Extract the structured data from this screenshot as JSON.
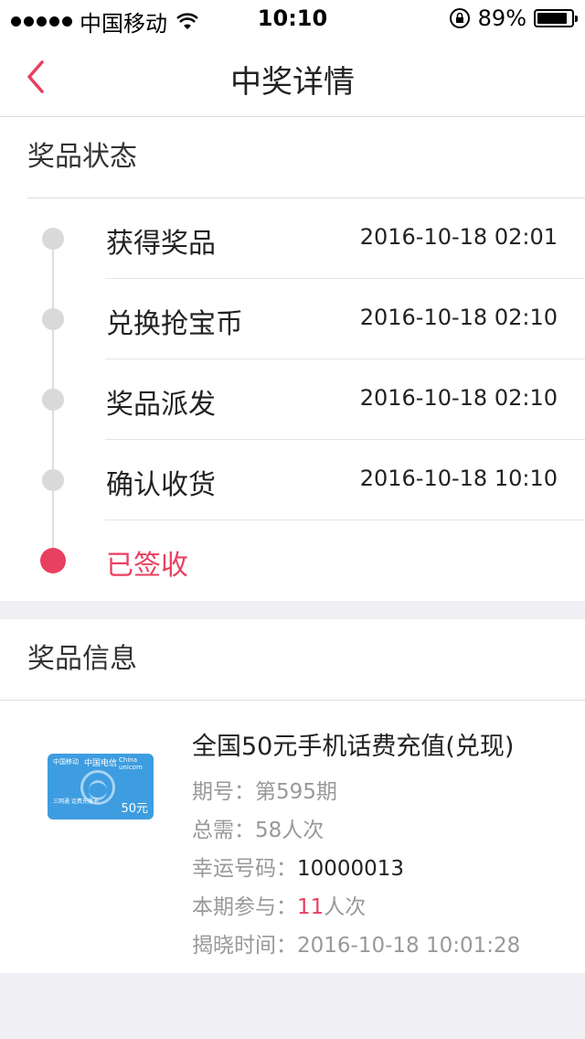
{
  "status_bar": {
    "carrier": "中国移动",
    "time": "10:10",
    "battery": "89%",
    "battery_level": 0.89
  },
  "nav": {
    "title": "中奖详情"
  },
  "prize_status": {
    "title": "奖品状态",
    "steps": [
      {
        "label": "获得奖品",
        "time": "2016-10-18 02:01"
      },
      {
        "label": "兑换抢宝币",
        "time": "2016-10-18 02:10"
      },
      {
        "label": "奖品派发",
        "time": "2016-10-18 02:10"
      },
      {
        "label": "确认收货",
        "time": "2016-10-18 10:10"
      },
      {
        "label": "已签收",
        "time": ""
      }
    ],
    "accent_color": "#e84060"
  },
  "prize_info": {
    "title": "奖品信息",
    "card": {
      "brand1": "中国移动",
      "brand2": "中国电信",
      "brand3": "China unicom",
      "caption": "三网通 话费充值卡",
      "amount": "50元"
    },
    "name": "全国50元手机话费充值(兑现)",
    "period_label": "期号：",
    "period_value": "第595期",
    "total_label": "总需：",
    "total_value": "58人次",
    "lucky_label": "幸运号码：",
    "lucky_value": "10000013",
    "join_label": "本期参与：",
    "join_count": "11",
    "join_unit": "人次",
    "reveal_label": "揭晓时间：",
    "reveal_value": "2016-10-18 10:01:28"
  }
}
